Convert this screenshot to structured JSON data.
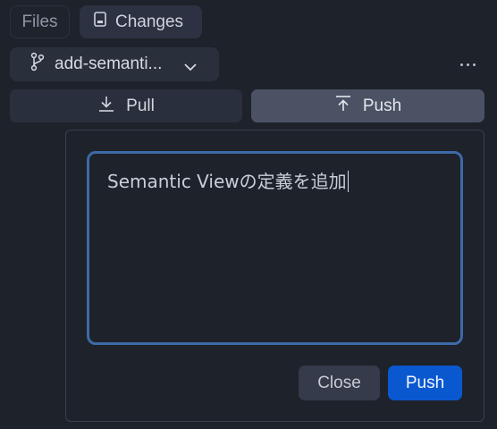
{
  "tabs": {
    "files_label": "Files",
    "changes_label": "Changes"
  },
  "branch": {
    "name": "add-semanti..."
  },
  "actions": {
    "pull_label": "Pull",
    "push_label": "Push"
  },
  "commit_dialog": {
    "message": "Semantic Viewの定義を追加",
    "close_label": "Close",
    "push_label": "Push"
  },
  "icons": {
    "changes": "document-icon",
    "branch": "git-branch-icon",
    "dropdown": "chevron-down-icon",
    "more": "more-horizontal-icon",
    "pull": "download-icon",
    "push": "upload-icon"
  },
  "colors": {
    "background": "#1e222b",
    "focus_border": "#3d6aa6",
    "primary_button": "#0a58d0"
  }
}
